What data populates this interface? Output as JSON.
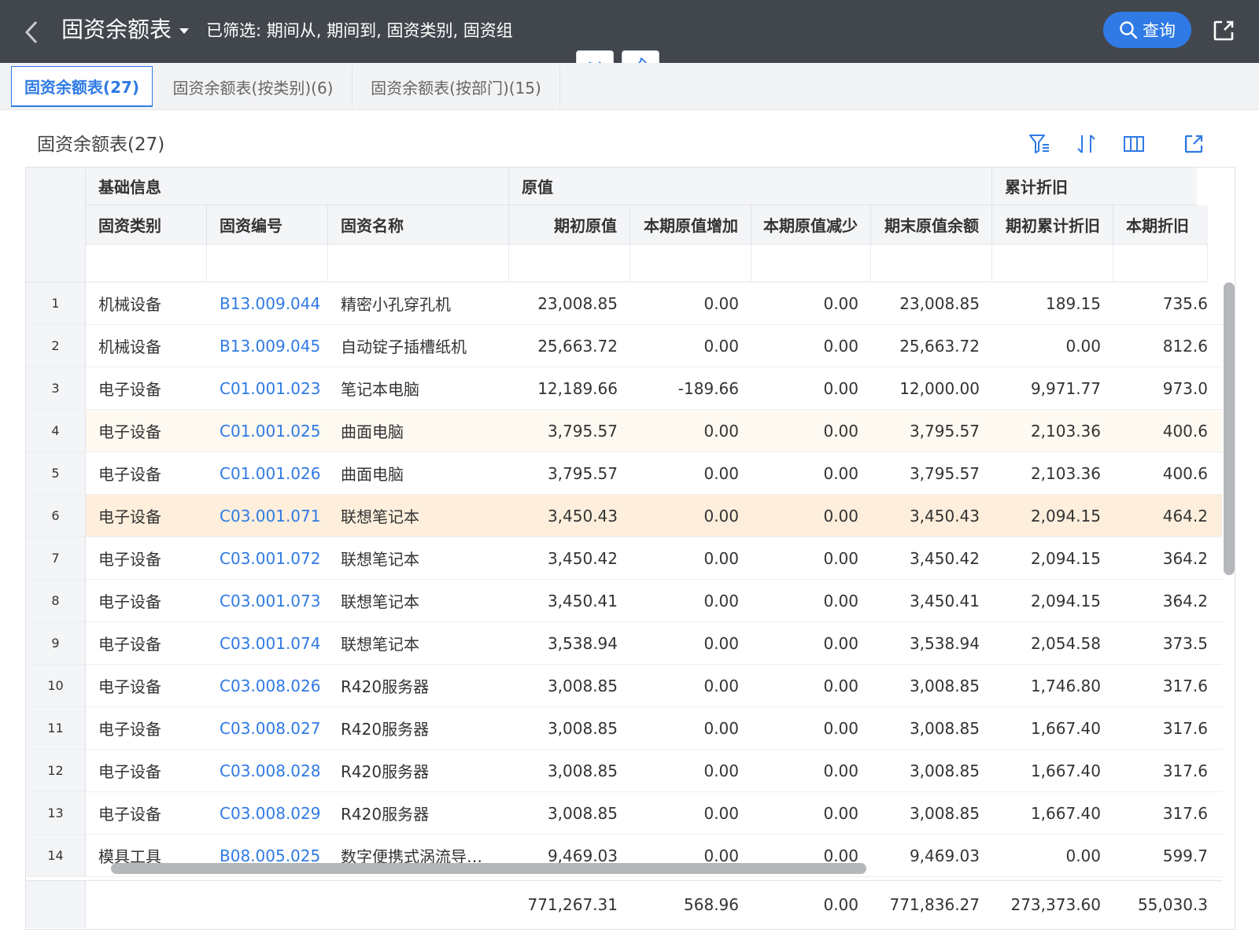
{
  "header": {
    "title": "固资余额表",
    "filter_summary": "已筛选: 期间从, 期间到, 固资类别, 固资组",
    "query_label": "查询"
  },
  "tabs": [
    {
      "label": "固资余额表(27)",
      "active": true
    },
    {
      "label": "固资余额表(按类别)(6)",
      "active": false
    },
    {
      "label": "固资余额表(按部门)(15)",
      "active": false
    }
  ],
  "section": {
    "title": "固资余额表(27)"
  },
  "table": {
    "groups": [
      "基础信息",
      "原值",
      "累计折旧"
    ],
    "columns": [
      "固资类别",
      "固资编号",
      "固资名称",
      "期初原值",
      "本期原值增加",
      "本期原值减少",
      "期末原值余额",
      "期初累计折旧",
      "本期折旧"
    ],
    "rows": [
      {
        "no": "1",
        "category": "机械设备",
        "code": "B13.009.044",
        "name": "精密小孔穿孔机",
        "opening": "23,008.85",
        "increase": "0.00",
        "decrease": "0.00",
        "closing": "23,008.85",
        "dep_opening": "189.15",
        "dep_period": "735.6"
      },
      {
        "no": "2",
        "category": "机械设备",
        "code": "B13.009.045",
        "name": "自动锭子插槽纸机",
        "opening": "25,663.72",
        "increase": "0.00",
        "decrease": "0.00",
        "closing": "25,663.72",
        "dep_opening": "0.00",
        "dep_period": "812.6"
      },
      {
        "no": "3",
        "category": "电子设备",
        "code": "C01.001.023",
        "name": "笔记本电脑",
        "opening": "12,189.66",
        "increase": "-189.66",
        "decrease": "0.00",
        "closing": "12,000.00",
        "dep_opening": "9,971.77",
        "dep_period": "973.0"
      },
      {
        "no": "4",
        "category": "电子设备",
        "code": "C01.001.025",
        "name": "曲面电脑",
        "opening": "3,795.57",
        "increase": "0.00",
        "decrease": "0.00",
        "closing": "3,795.57",
        "dep_opening": "2,103.36",
        "dep_period": "400.6"
      },
      {
        "no": "5",
        "category": "电子设备",
        "code": "C01.001.026",
        "name": "曲面电脑",
        "opening": "3,795.57",
        "increase": "0.00",
        "decrease": "0.00",
        "closing": "3,795.57",
        "dep_opening": "2,103.36",
        "dep_period": "400.6"
      },
      {
        "no": "6",
        "category": "电子设备",
        "code": "C03.001.071",
        "name": "联想笔记本",
        "opening": "3,450.43",
        "increase": "0.00",
        "decrease": "0.00",
        "closing": "3,450.43",
        "dep_opening": "2,094.15",
        "dep_period": "464.2"
      },
      {
        "no": "7",
        "category": "电子设备",
        "code": "C03.001.072",
        "name": "联想笔记本",
        "opening": "3,450.42",
        "increase": "0.00",
        "decrease": "0.00",
        "closing": "3,450.42",
        "dep_opening": "2,094.15",
        "dep_period": "364.2"
      },
      {
        "no": "8",
        "category": "电子设备",
        "code": "C03.001.073",
        "name": "联想笔记本",
        "opening": "3,450.41",
        "increase": "0.00",
        "decrease": "0.00",
        "closing": "3,450.41",
        "dep_opening": "2,094.15",
        "dep_period": "364.2"
      },
      {
        "no": "9",
        "category": "电子设备",
        "code": "C03.001.074",
        "name": "联想笔记本",
        "opening": "3,538.94",
        "increase": "0.00",
        "decrease": "0.00",
        "closing": "3,538.94",
        "dep_opening": "2,054.58",
        "dep_period": "373.5"
      },
      {
        "no": "10",
        "category": "电子设备",
        "code": "C03.008.026",
        "name": "R420服务器",
        "opening": "3,008.85",
        "increase": "0.00",
        "decrease": "0.00",
        "closing": "3,008.85",
        "dep_opening": "1,746.80",
        "dep_period": "317.6"
      },
      {
        "no": "11",
        "category": "电子设备",
        "code": "C03.008.027",
        "name": "R420服务器",
        "opening": "3,008.85",
        "increase": "0.00",
        "decrease": "0.00",
        "closing": "3,008.85",
        "dep_opening": "1,667.40",
        "dep_period": "317.6"
      },
      {
        "no": "12",
        "category": "电子设备",
        "code": "C03.008.028",
        "name": "R420服务器",
        "opening": "3,008.85",
        "increase": "0.00",
        "decrease": "0.00",
        "closing": "3,008.85",
        "dep_opening": "1,667.40",
        "dep_period": "317.6"
      },
      {
        "no": "13",
        "category": "电子设备",
        "code": "C03.008.029",
        "name": "R420服务器",
        "opening": "3,008.85",
        "increase": "0.00",
        "decrease": "0.00",
        "closing": "3,008.85",
        "dep_opening": "1,667.40",
        "dep_period": "317.6"
      },
      {
        "no": "14",
        "category": "模具工具",
        "code": "B08.005.025",
        "name": "数字便携式涡流导…",
        "opening": "9,469.03",
        "increase": "0.00",
        "decrease": "0.00",
        "closing": "9,469.03",
        "dep_opening": "0.00",
        "dep_period": "599.7"
      }
    ],
    "totals": {
      "opening": "771,267.31",
      "increase": "568.96",
      "decrease": "0.00",
      "closing": "771,836.27",
      "dep_opening": "273,373.60",
      "dep_period": "55,030.3"
    },
    "hover_row": 4,
    "selected_row": 6
  },
  "icons": {
    "back": "chevron-left-icon",
    "title_caret": "caret-down-icon",
    "query": "search-icon",
    "export": "export-icon",
    "collapse": "chevron-down-icon",
    "pin": "pin-icon",
    "filter": "filter-icon",
    "sort": "sort-icon",
    "columns": "columns-icon"
  },
  "colors": {
    "header_bg": "#42464d",
    "accent": "#2f7ae5",
    "selected_row": "#fdefdc",
    "hover_row": "#fef9f1"
  }
}
